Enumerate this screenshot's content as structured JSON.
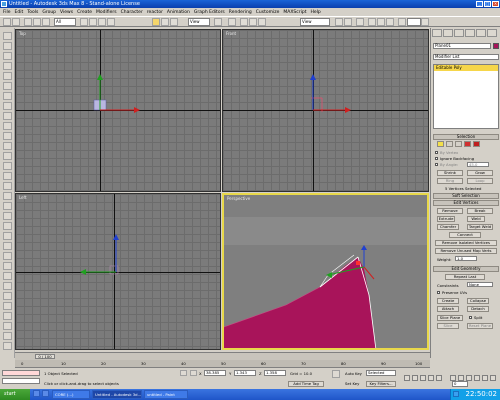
{
  "window": {
    "title": "Untitled - Autodesk 3ds Max 8 - Stand-alone License",
    "controls": [
      "_",
      "□",
      "×"
    ]
  },
  "menubar": {
    "items": [
      "File",
      "Edit",
      "Tools",
      "Group",
      "Views",
      "Create",
      "Modifiers",
      "Character",
      "reactor",
      "Animation",
      "Graph Editors",
      "Rendering",
      "Customize",
      "MAXScript",
      "Help"
    ]
  },
  "toolbar": {
    "selection_filter": "All",
    "ref_coord": "View",
    "named_selection": "View"
  },
  "viewports": {
    "top": "Top",
    "front": "Front",
    "left": "Left",
    "perspective": "Perspective"
  },
  "command_panel": {
    "object_name": "Plane01",
    "modifier_list": "Modifier List",
    "stack_item": "Editable Poly",
    "selection": {
      "title": "Selection",
      "by_vertex": "By Vertex",
      "ignore_backfacing": "Ignore Backfacing",
      "by_angle": "By Angle:",
      "by_angle_value": "45.0",
      "shrink": "Shrink",
      "grow": "Grow",
      "ring": "Ring",
      "loop": "Loop",
      "status": "5 Vertices Selected"
    },
    "soft_selection": "Soft Selection",
    "edit_vertices": {
      "title": "Edit Vertices",
      "remove": "Remove",
      "break": "Break",
      "extrude": "Extrude",
      "weld": "Weld",
      "chamfer": "Chamfer",
      "target_weld": "Target Weld",
      "connect": "Connect",
      "remove_isolated": "Remove Isolated Vertices",
      "remove_unused": "Remove Unused Map Verts",
      "weight_label": "Weight:",
      "weight_value": "1.0"
    },
    "edit_geometry": {
      "title": "Edit Geometry",
      "repeat_last": "Repeat Last",
      "constraints_label": "Constraints",
      "constraints_value": "None",
      "preserve_uvs": "Preserve UVs",
      "create": "Create",
      "collapse": "Collapse",
      "attach": "Attach",
      "detach": "Detach",
      "slice_plane": "Slice Plane",
      "split": "Split",
      "slice": "Slice",
      "reset_plane": "Reset Plane"
    }
  },
  "timeline": {
    "frame": "0 / 100",
    "ticks": [
      "0",
      "10",
      "20",
      "30",
      "40",
      "50",
      "60",
      "70",
      "80",
      "90",
      "100"
    ]
  },
  "status": {
    "selected": "1 Object Selected",
    "prompt": "Click or click-and-drag to select objects",
    "x_value": "38.385",
    "y_value": "1.343",
    "z_value": "1.358",
    "grid": "Grid = 10.0",
    "add_time_tag": "Add Time Tag",
    "auto_key": "Auto Key",
    "auto_key_value": "Selected",
    "set_key": "Set Key",
    "key_filters": "Key Filters...",
    "frame_field": "0"
  },
  "taskbar": {
    "start": "start",
    "tasks": [
      "CORE (...)",
      "Untitled - Autodesk 3d...",
      "untitled - Paint"
    ],
    "clock": "22:50:02"
  },
  "colors": {
    "object": "#a8145a",
    "selected_viewport_border": "#e8d84a",
    "stack_highlight": "#f6d64a"
  }
}
